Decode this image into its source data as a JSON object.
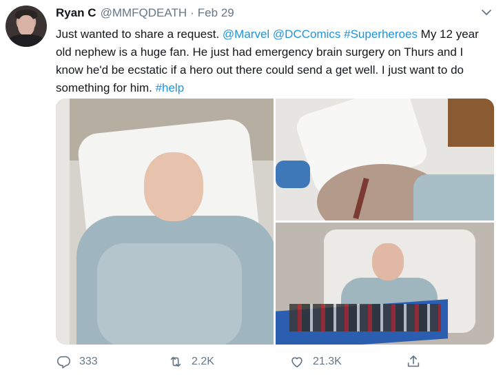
{
  "tweet": {
    "author_name": "Ryan C",
    "author_handle": "@MMFQDEATH",
    "separator": "·",
    "date": "Feb 29",
    "text_parts": [
      {
        "text": "Just wanted to share a request. ",
        "link": false
      },
      {
        "text": "@Marvel",
        "link": true
      },
      {
        "text": " ",
        "link": false
      },
      {
        "text": "@DCComics",
        "link": true
      },
      {
        "text": " ",
        "link": false
      },
      {
        "text": "#Superheroes",
        "link": true
      },
      {
        "text": " My 12 year old nephew is a huge fan. He just had emergency brain surgery on Thurs and I know he'd be ecstatic if a hero out there could send a get well. I just want to do something for him. ",
        "link": false
      },
      {
        "text": "#help",
        "link": true
      }
    ]
  },
  "actions": {
    "reply_count": "333",
    "retweet_count": "2.2K",
    "like_count": "21.3K"
  },
  "icons": {
    "reply": "reply-icon",
    "retweet": "retweet-icon",
    "like": "heart-icon",
    "share": "share-icon",
    "menu": "chevron-down-icon"
  },
  "colors": {
    "link": "#1b95e0",
    "secondary_text": "#657786",
    "primary_text": "#14171a"
  }
}
